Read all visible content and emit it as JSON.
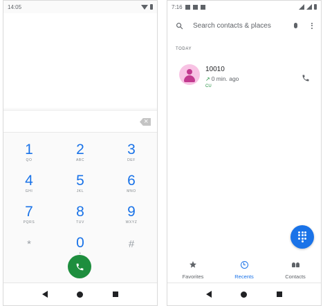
{
  "dialer": {
    "status_time": "14:05",
    "keys": [
      {
        "digit": "1",
        "letters": "QO"
      },
      {
        "digit": "2",
        "letters": "ABC"
      },
      {
        "digit": "3",
        "letters": "DEF"
      },
      {
        "digit": "4",
        "letters": "GHI"
      },
      {
        "digit": "5",
        "letters": "JKL"
      },
      {
        "digit": "6",
        "letters": "MNO"
      },
      {
        "digit": "7",
        "letters": "PQRS"
      },
      {
        "digit": "8",
        "letters": "TUV"
      },
      {
        "digit": "9",
        "letters": "WXYZ"
      },
      {
        "digit": "*",
        "letters": ""
      },
      {
        "digit": "0",
        "letters": "+"
      },
      {
        "digit": "#",
        "letters": ""
      }
    ]
  },
  "recents": {
    "status_time": "7:16",
    "search_placeholder": "Search contacts & places",
    "section_header": "TODAY",
    "calls": [
      {
        "name": "10010",
        "time": "0 min. ago",
        "sim": "CU"
      }
    ],
    "tabs": [
      {
        "label": "Favorites",
        "icon": "star-icon",
        "active": false
      },
      {
        "label": "Recents",
        "icon": "clock-icon",
        "active": true
      },
      {
        "label": "Contacts",
        "icon": "people-icon",
        "active": false
      }
    ]
  },
  "colors": {
    "accent_blue": "#1a73e8",
    "call_green": "#1e8e3e",
    "avatar_bg": "#f8c3e4",
    "avatar_fg": "#c23a8f"
  }
}
